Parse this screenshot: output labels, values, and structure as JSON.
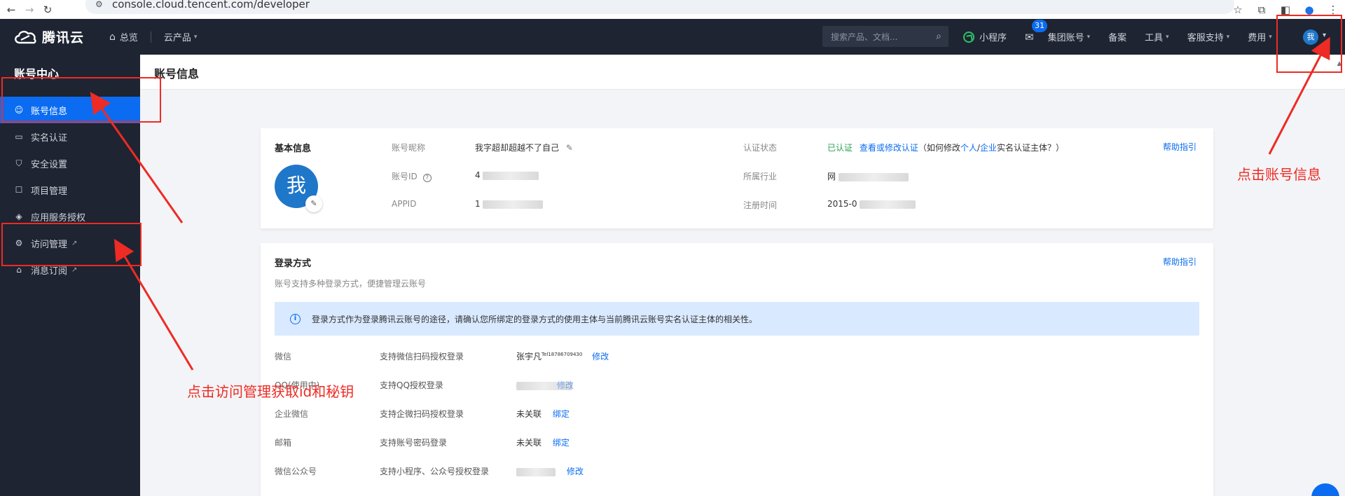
{
  "browser": {
    "url": "console.cloud.tencent.com/developer"
  },
  "header": {
    "brand": "腾讯云",
    "overview": "总览",
    "products": "云产品",
    "search_placeholder": "搜索产品、文档...",
    "mini_program": "小程序",
    "mail_badge": "31",
    "group_account": "集团账号",
    "filing": "备案",
    "tools": "工具",
    "support": "客服支持",
    "billing": "费用",
    "avatar": "我"
  },
  "sidebar": {
    "title": "账号中心",
    "items": [
      {
        "label": "账号信息",
        "icon": "user-icon",
        "active": true
      },
      {
        "label": "实名认证",
        "icon": "id-card-icon"
      },
      {
        "label": "安全设置",
        "icon": "shield-icon"
      },
      {
        "label": "项目管理",
        "icon": "project-icon"
      },
      {
        "label": "应用服务授权",
        "icon": "layers-icon"
      },
      {
        "label": "访问管理",
        "icon": "access-icon",
        "external": true
      },
      {
        "label": "消息订阅",
        "icon": "subscribe-icon",
        "external": true
      }
    ]
  },
  "main": {
    "page_title": "账号信息",
    "basic_info": {
      "title": "基本信息",
      "help": "帮助指引",
      "avatar": "我",
      "nickname_label": "账号昵称",
      "nickname": "我字超却超越不了自己",
      "account_id_label": "账号ID",
      "account_id_visible": "4",
      "appid_label": "APPID",
      "appid_visible": "1",
      "auth_status_label": "认证状态",
      "auth_status": "已认证",
      "auth_link": "查看或修改认证",
      "auth_hint_pre": "（如何修改",
      "auth_hint_personal": "个人",
      "auth_hint_slash": "/",
      "auth_hint_company": "企业",
      "auth_hint_post": "实名认证主体？）",
      "industry_label": "所属行业",
      "industry_visible": "网",
      "register_label": "注册时间",
      "register_visible": "2015-0"
    },
    "login": {
      "title": "登录方式",
      "help": "帮助指引",
      "subtitle": "账号支持多种登录方式，便捷管理云账号",
      "notice": "登录方式作为登录腾讯云账号的途径，请确认您所绑定的登录方式的使用主体与当前腾讯云账号实名认证主体的相关性。",
      "rows": [
        {
          "label": "微信",
          "desc": "支持微信扫码授权登录",
          "value": "张宇凡",
          "value_tag": "Tel18786709430",
          "action": "修改"
        },
        {
          "label": "QQ(使用中)",
          "desc": "支持QQ授权登录",
          "value": "",
          "value_tag": "",
          "action": "修改"
        },
        {
          "label": "企业微信",
          "desc": "支持企微扫码授权登录",
          "value": "未关联",
          "value_tag": "",
          "action": "绑定"
        },
        {
          "label": "邮箱",
          "desc": "支持账号密码登录",
          "value": "未关联",
          "value_tag": "",
          "action": "绑定"
        },
        {
          "label": "微信公众号",
          "desc": "支持小程序、公众号授权登录",
          "value": "",
          "value_tag": "",
          "action": "修改"
        }
      ]
    }
  },
  "annotations": {
    "account_info_hint": "点击账号信息",
    "access_hint": "点击访问管理获取id和秘钥",
    "color": "#ee2b24"
  }
}
